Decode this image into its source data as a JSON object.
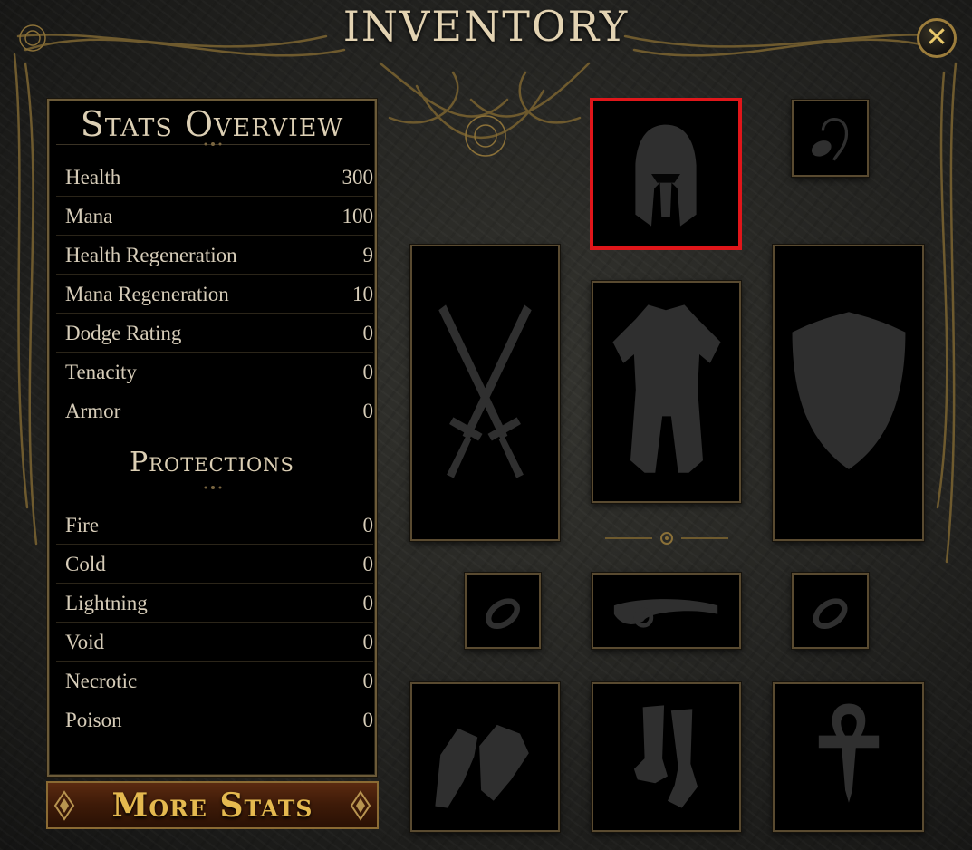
{
  "window": {
    "title": "INVENTORY",
    "close_icon": "close-icon"
  },
  "stats_panel": {
    "heading": "Stats Overview",
    "stats": [
      {
        "label": "Health",
        "value": "300"
      },
      {
        "label": "Mana",
        "value": "100"
      },
      {
        "label": "Health Regeneration",
        "value": "9"
      },
      {
        "label": "Mana Regeneration",
        "value": "10"
      },
      {
        "label": "Dodge Rating",
        "value": "0"
      },
      {
        "label": "Tenacity",
        "value": "0"
      },
      {
        "label": "Armor",
        "value": "0"
      }
    ],
    "protections_heading": "Protections",
    "protections": [
      {
        "label": "Fire",
        "value": "0"
      },
      {
        "label": "Cold",
        "value": "0"
      },
      {
        "label": "Lightning",
        "value": "0"
      },
      {
        "label": "Void",
        "value": "0"
      },
      {
        "label": "Necrotic",
        "value": "0"
      },
      {
        "label": "Poison",
        "value": "0"
      }
    ],
    "more_stats_label": "More Stats"
  },
  "equipment_slots": [
    {
      "slot": "head",
      "icon": "helmet-icon",
      "selected": true
    },
    {
      "slot": "neck",
      "icon": "amulet-icon",
      "selected": false
    },
    {
      "slot": "main-hand",
      "icon": "crossed-swords-icon",
      "selected": false
    },
    {
      "slot": "chest",
      "icon": "armor-icon",
      "selected": false
    },
    {
      "slot": "off-hand",
      "icon": "shield-icon",
      "selected": false
    },
    {
      "slot": "ring-left",
      "icon": "ring-icon",
      "selected": false
    },
    {
      "slot": "belt",
      "icon": "belt-icon",
      "selected": false
    },
    {
      "slot": "ring-right",
      "icon": "ring-icon",
      "selected": false
    },
    {
      "slot": "hands",
      "icon": "gloves-icon",
      "selected": false
    },
    {
      "slot": "feet",
      "icon": "boots-icon",
      "selected": false
    },
    {
      "slot": "relic",
      "icon": "ankh-icon",
      "selected": false
    }
  ],
  "colors": {
    "selection": "#e0161a",
    "gold": "#9c7d3c",
    "button_text": "#e5b94f",
    "slot_icon": "#2f2f2f"
  }
}
